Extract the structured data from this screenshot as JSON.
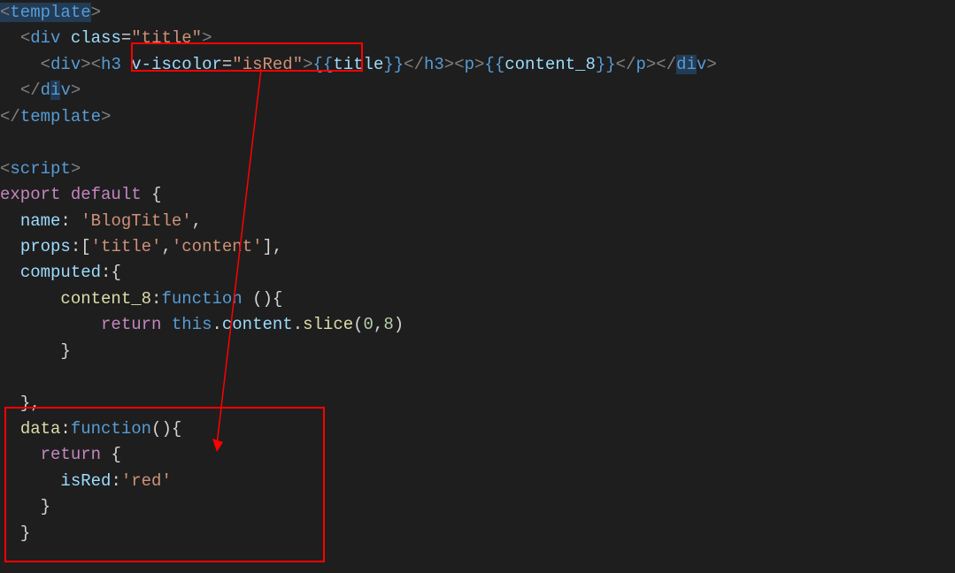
{
  "code": {
    "line1": {
      "open_tag": "template",
      "close_bracket": ">"
    },
    "line2": {
      "indent": "  ",
      "open": "<",
      "tag": "div",
      "space": " ",
      "attr": "class",
      "eq": "=",
      "val": "\"title\"",
      "close": ">"
    },
    "line3": {
      "indent": "    ",
      "t_div_open": "<div>",
      "t_h3_open": "<h3",
      "space": " ",
      "attr": "v-iscolor",
      "eq": "=",
      "val": "\"isRed\"",
      "close": ">",
      "m_open1": "{{",
      "mvar1": "title",
      "m_close1": "}}",
      "t_h3_close": "</h3>",
      "t_p_open": "<p>",
      "m_open2": "{{",
      "mvar2": "content_8",
      "m_close2": "}}",
      "t_p_close": "</p>",
      "t_div_close": "</div>"
    },
    "line4": {
      "indent": "  ",
      "t": "</div>"
    },
    "line5": {
      "t": "</template>"
    },
    "line7": {
      "t": "<script>"
    },
    "line8": {
      "export": "export",
      "space": " ",
      "default": "default",
      "space2": " ",
      "brace": "{"
    },
    "line9": {
      "indent": "  ",
      "key": "name",
      "colon": ": ",
      "val": "'BlogTitle'",
      "comma": ","
    },
    "line10": {
      "indent": "  ",
      "key": "props",
      "colon": ":",
      "arr": "[",
      "v1": "'title'",
      "c": ",",
      "v2": "'content'",
      "arr2": "]",
      "comma": ","
    },
    "line11": {
      "indent": "  ",
      "key": "computed",
      "colon": ":",
      "brace": "{"
    },
    "line12": {
      "indent": "      ",
      "key": "content_8",
      "colon": ":",
      "func": "function",
      "space": " ",
      "paren": "()",
      "brace": "{"
    },
    "line13": {
      "indent": "          ",
      "ret": "return",
      "space": " ",
      "this": "this",
      "dot": ".",
      "prop": "content",
      "dot2": ".",
      "method": "slice",
      "paren_o": "(",
      "arg1": "0",
      "comma": ",",
      "arg2": "8",
      "paren_c": ")"
    },
    "line14": {
      "indent": "      ",
      "brace": "}"
    },
    "line16": {
      "indent": "  ",
      "brace": "}",
      "comma": ","
    },
    "line17": {
      "indent": "  ",
      "key": "data",
      "colon": ":",
      "func": "function",
      "paren": "()",
      "brace": "{"
    },
    "line18": {
      "indent": "    ",
      "ret": "return",
      "space": " ",
      "brace": "{"
    },
    "line19": {
      "indent": "      ",
      "key": "isRed",
      "colon": ":",
      "val": "'red'"
    },
    "line20": {
      "indent": "    ",
      "brace": "}"
    },
    "line21": {
      "indent": "  ",
      "brace": "}"
    }
  },
  "annotations": {
    "box1": "highlight-v-iscolor",
    "box2": "highlight-data-function",
    "arrow": "arrow-annotation"
  }
}
